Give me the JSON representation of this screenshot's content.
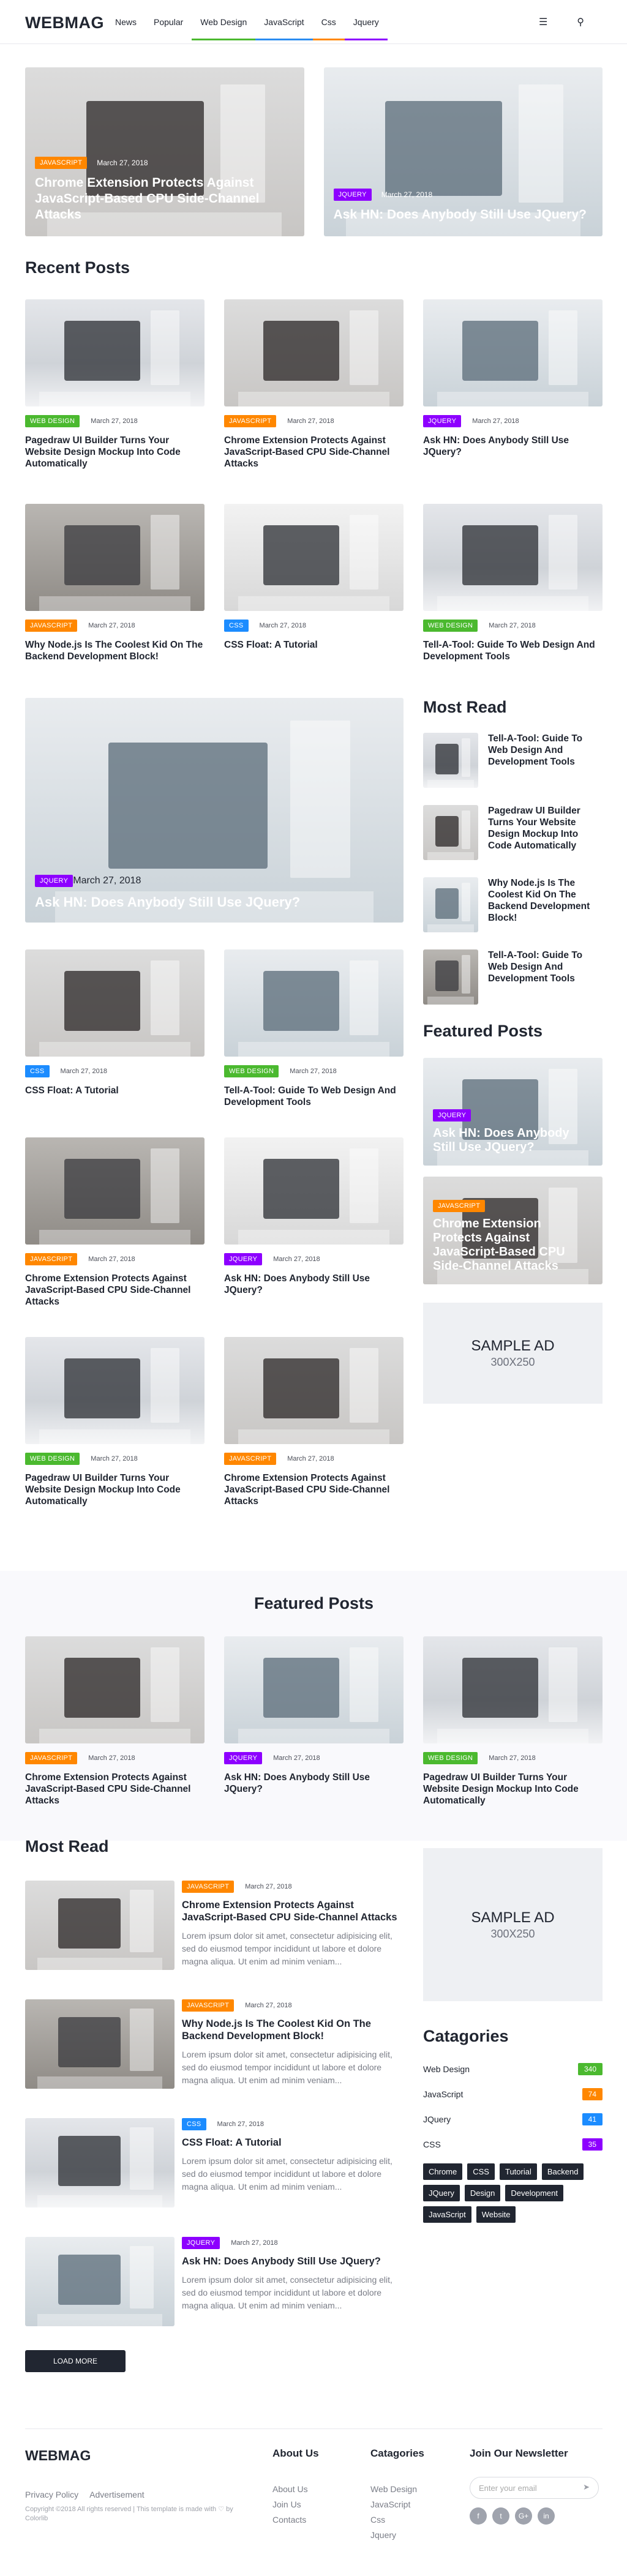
{
  "brand": {
    "logo_a": "WEB",
    "logo_b": "MAG"
  },
  "nav": [
    {
      "label": "News",
      "color": "transparent"
    },
    {
      "label": "Popular",
      "color": "transparent"
    },
    {
      "label": "Web Design",
      "color": "#4bb92f"
    },
    {
      "label": "JavaScript",
      "color": "#2b8cf0"
    },
    {
      "label": "Css",
      "color": "#ff8700"
    },
    {
      "label": "Jquery",
      "color": "#8d00ff"
    }
  ],
  "icons": {
    "menu": "☰",
    "search": "⚲"
  },
  "tag_colors": {
    "JAVASCRIPT": "#ff8700",
    "JQUERY": "#8d00ff",
    "WEB DESIGN": "#4bb92f",
    "CSS": "#1c8cff"
  },
  "hero": [
    {
      "tag": "JAVASCRIPT",
      "date": "March 27, 2018",
      "title": "Chrome Extension Protects Against JavaScript-Based CPU Side-Channel Attacks"
    },
    {
      "tag": "JQUERY",
      "date": "March 27, 2018",
      "title": "Ask HN: Does Anybody Still Use JQuery?"
    }
  ],
  "recent": {
    "title": "Recent Posts",
    "row1": [
      {
        "tag": "WEB DESIGN",
        "date": "March 27, 2018",
        "title": "Pagedraw UI Builder Turns Your Website Design Mockup Into Code Automatically"
      },
      {
        "tag": "JAVASCRIPT",
        "date": "March 27, 2018",
        "title": "Chrome Extension Protects Against JavaScript-Based CPU Side-Channel Attacks"
      },
      {
        "tag": "JQUERY",
        "date": "March 27, 2018",
        "title": "Ask HN: Does Anybody Still Use JQuery?"
      }
    ],
    "row2": [
      {
        "tag": "JAVASCRIPT",
        "date": "March 27, 2018",
        "title": "Why Node.js Is The Coolest Kid On The Backend Development Block!"
      },
      {
        "tag": "CSS",
        "date": "March 27, 2018",
        "title": "CSS Float: A Tutorial"
      },
      {
        "tag": "WEB DESIGN",
        "date": "March 27, 2018",
        "title": "Tell-A-Tool: Guide To Web Design And Development Tools"
      }
    ],
    "big": {
      "tag": "JQUERY",
      "date": "March 27, 2018",
      "title": "Ask HN: Does Anybody Still Use JQuery?"
    },
    "left": [
      {
        "tag": "CSS",
        "date": "March 27, 2018",
        "title": "CSS Float: A Tutorial"
      },
      {
        "tag": "WEB DESIGN",
        "date": "March 27, 2018",
        "title": "Tell-A-Tool: Guide To Web Design And Development Tools"
      },
      {
        "tag": "JAVASCRIPT",
        "date": "March 27, 2018",
        "title": "Chrome Extension Protects Against JavaScript-Based CPU Side-Channel Attacks"
      },
      {
        "tag": "JQUERY",
        "date": "March 27, 2018",
        "title": "Ask HN: Does Anybody Still Use JQuery?"
      },
      {
        "tag": "WEB DESIGN",
        "date": "March 27, 2018",
        "title": "Pagedraw UI Builder Turns Your Website Design Mockup Into Code Automatically"
      },
      {
        "tag": "JAVASCRIPT",
        "date": "March 27, 2018",
        "title": "Chrome Extension Protects Against JavaScript-Based CPU Side-Channel Attacks"
      }
    ]
  },
  "most_read_side": {
    "title": "Most Read",
    "items": [
      "Tell-A-Tool: Guide To Web Design And Development Tools",
      "Pagedraw UI Builder Turns Your Website Design Mockup Into Code Automatically",
      "Why Node.js Is The Coolest Kid On The Backend Development Block!",
      "Tell-A-Tool: Guide To Web Design And Development Tools"
    ]
  },
  "featured_side": {
    "title": "Featured Posts",
    "items": [
      {
        "tag": "JQUERY",
        "title": "Ask HN: Does Anybody Still Use JQuery?"
      },
      {
        "tag": "JAVASCRIPT",
        "title": "Chrome Extension Protects Against JavaScript-Based CPU Side-Channel Attacks"
      }
    ]
  },
  "ad": {
    "line1": "SAMPLE AD",
    "line2": "300X250"
  },
  "featured_band": {
    "title": "Featured Posts",
    "items": [
      {
        "tag": "JAVASCRIPT",
        "date": "March 27, 2018",
        "title": "Chrome Extension Protects Against JavaScript-Based CPU Side-Channel Attacks"
      },
      {
        "tag": "JQUERY",
        "date": "March 27, 2018",
        "title": "Ask HN: Does Anybody Still Use JQuery?"
      },
      {
        "tag": "WEB DESIGN",
        "date": "March 27, 2018",
        "title": "Pagedraw UI Builder Turns Your Website Design Mockup Into Code Automatically"
      }
    ]
  },
  "most_read": {
    "title": "Most Read",
    "excerpt": "Lorem ipsum dolor sit amet, consectetur adipisicing elit, sed do eiusmod tempor incididunt ut labore et dolore magna aliqua. Ut enim ad minim veniam...",
    "load_more": "Load More",
    "items": [
      {
        "tag": "JAVASCRIPT",
        "date": "March 27, 2018",
        "title": "Chrome Extension Protects Against JavaScript-Based CPU Side-Channel Attacks"
      },
      {
        "tag": "JAVASCRIPT",
        "date": "March 27, 2018",
        "title": "Why Node.js Is The Coolest Kid On The Backend Development Block!"
      },
      {
        "tag": "CSS",
        "date": "March 27, 2018",
        "title": "CSS Float: A Tutorial"
      },
      {
        "tag": "JQUERY",
        "date": "March 27, 2018",
        "title": "Ask HN: Does Anybody Still Use JQuery?"
      }
    ]
  },
  "categories": {
    "title": "Catagories",
    "items": [
      {
        "name": "Web Design",
        "count": "340",
        "color": "#4bb92f"
      },
      {
        "name": "JavaScript",
        "count": "74",
        "color": "#ff8700"
      },
      {
        "name": "JQuery",
        "count": "41",
        "color": "#1c8cff"
      },
      {
        "name": "CSS",
        "count": "35",
        "color": "#8d00ff"
      }
    ],
    "tags": [
      "Chrome",
      "CSS",
      "Tutorial",
      "Backend",
      "JQuery",
      "Design",
      "Development",
      "JavaScript",
      "Website"
    ]
  },
  "footer": {
    "links": [
      "Privacy Policy",
      "Advertisement"
    ],
    "copyright": "Copyright ©2018 All rights reserved | This template is made with ♡ by Colorlib",
    "about_title": "About Us",
    "about_links": [
      "About Us",
      "Join Us",
      "Contacts"
    ],
    "cat_title": "Catagories",
    "cat_links": [
      "Web Design",
      "JavaScript",
      "Css",
      "Jquery"
    ],
    "newsletter_title": "Join Our Newsletter",
    "newsletter_placeholder": "Enter your email",
    "social": [
      "f",
      "t",
      "G+",
      "in"
    ]
  }
}
